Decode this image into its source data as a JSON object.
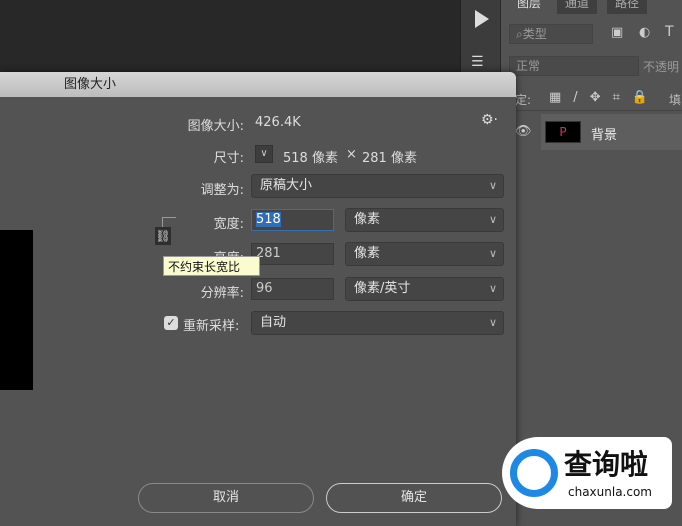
{
  "layers_panel": {
    "tabs": [
      "图层",
      "通道",
      "路径"
    ],
    "filter_label": "类型",
    "blend_mode": "正常",
    "opacity_label": "不透明",
    "lock_label": "锁定:",
    "fill_label": "填",
    "layer": {
      "name": "背景",
      "thumbnail_letter": "P"
    }
  },
  "dialog": {
    "title": "图像大小",
    "image_size_label": "图像大小:",
    "image_size_value": "426.4K",
    "dimensions_label": "尺寸:",
    "dimensions_width": "518 像素",
    "dimensions_x": "×",
    "dimensions_height": "281 像素",
    "fit_to_label": "调整为:",
    "fit_to_value": "原稿大小",
    "width_label": "宽度:",
    "width_value": "518",
    "width_unit": "像素",
    "height_label": "高度:",
    "height_value": "281",
    "height_unit": "像素",
    "resolution_label": "分辨率:",
    "resolution_value": "96",
    "resolution_unit": "像素/英寸",
    "resample_label": "重新采样:",
    "resample_checked": true,
    "resample_value": "自动",
    "tooltip": "不约束长宽比",
    "cancel": "取消",
    "ok": "确定"
  },
  "watermark": {
    "brand": "查询啦",
    "url": "chaxunla.com"
  }
}
